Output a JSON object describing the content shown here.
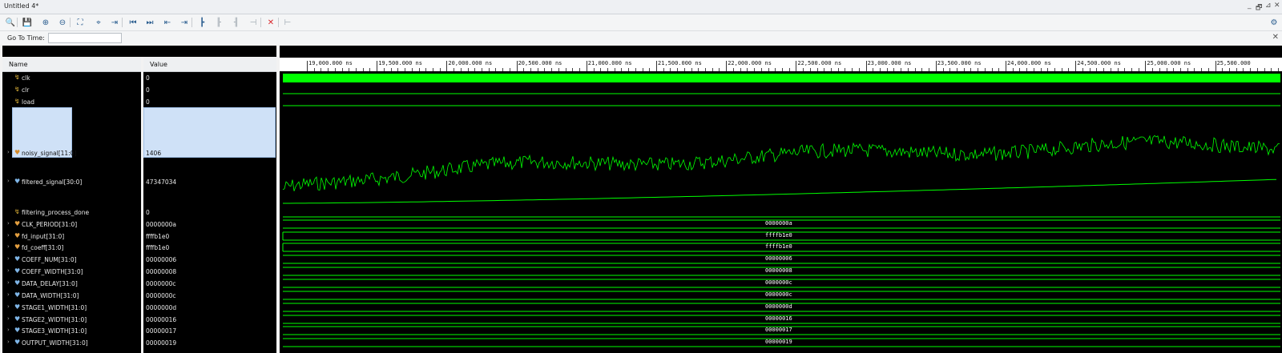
{
  "window": {
    "title": "Untitled 4*",
    "controls": [
      "_",
      "🗗",
      "⊿",
      "✕"
    ]
  },
  "toolbar": {
    "icons": [
      {
        "name": "search-icon",
        "glyph": "🔍"
      },
      {
        "name": "save-icon",
        "glyph": "💾"
      },
      {
        "name": "zoom-in-icon",
        "glyph": "⊕"
      },
      {
        "name": "zoom-out-icon",
        "glyph": "⊖"
      },
      {
        "name": "zoom-fit-icon",
        "glyph": "⛶"
      },
      {
        "name": "cursor-center-icon",
        "glyph": "⌖"
      },
      {
        "name": "go-to-cursor-icon",
        "glyph": "⇥"
      },
      {
        "name": "go-to-start-icon",
        "glyph": "⏮"
      },
      {
        "name": "go-to-end-icon",
        "glyph": "⏭"
      },
      {
        "name": "prev-transition-icon",
        "glyph": "⇤"
      },
      {
        "name": "next-transition-icon",
        "glyph": "⇥"
      },
      {
        "name": "add-marker-icon",
        "glyph": "┣"
      },
      {
        "name": "prev-marker-icon",
        "glyph": "╟"
      },
      {
        "name": "next-marker-icon",
        "glyph": "╢"
      },
      {
        "name": "swap-cursors-icon",
        "glyph": "⊣"
      },
      {
        "name": "delete-icon",
        "glyph": "✕"
      },
      {
        "name": "snap-icon",
        "glyph": "⊢"
      }
    ],
    "settings_glyph": "⚙"
  },
  "goto": {
    "label": "Go To Time:",
    "value": "",
    "close": "✕"
  },
  "columns": {
    "name": "Name",
    "value": "Value"
  },
  "signals": [
    {
      "name": "clk",
      "value": "0",
      "kind": "bit",
      "expand": false
    },
    {
      "name": "clr",
      "value": "0",
      "kind": "bit",
      "expand": false
    },
    {
      "name": "load",
      "value": "0",
      "kind": "bit",
      "expand": false
    },
    {
      "name": "noisy_signal[11:0]",
      "value": "1406",
      "kind": "analog",
      "expand": true,
      "selected": true
    },
    {
      "name": "filtered_signal[30:0]",
      "value": "47347034",
      "kind": "analog",
      "expand": true
    },
    {
      "name": "filtering_process_done",
      "value": "0",
      "kind": "bit",
      "expand": false
    },
    {
      "name": "CLK_PERIOD[31:0]",
      "value": "0000000a",
      "bus": "0000000a",
      "kind": "param",
      "expand": true
    },
    {
      "name": "fd_input[31:0]",
      "value": "ffffb1e0",
      "bus": "ffffb1e0",
      "kind": "param",
      "expand": true
    },
    {
      "name": "fd_coeff[31:0]",
      "value": "ffffb1e0",
      "bus": "ffffb1e0",
      "kind": "param",
      "expand": true
    },
    {
      "name": "COEFF_NUM[31:0]",
      "value": "00000006",
      "bus": "00000006",
      "kind": "param",
      "expand": true
    },
    {
      "name": "COEFF_WIDTH[31:0]",
      "value": "00000008",
      "bus": "00000008",
      "kind": "param",
      "expand": true
    },
    {
      "name": "DATA_DELAY[31:0]",
      "value": "0000000c",
      "bus": "0000000c",
      "kind": "param",
      "expand": true
    },
    {
      "name": "DATA_WIDTH[31:0]",
      "value": "0000000c",
      "bus": "0000000c",
      "kind": "param",
      "expand": true
    },
    {
      "name": "STAGE1_WIDTH[31:0]",
      "value": "0000000d",
      "bus": "0000000d",
      "kind": "param",
      "expand": true
    },
    {
      "name": "STAGE2_WIDTH[31:0]",
      "value": "00000016",
      "bus": "00000016",
      "kind": "param",
      "expand": true
    },
    {
      "name": "STAGE3_WIDTH[31:0]",
      "value": "00000017",
      "bus": "00000017",
      "kind": "param",
      "expand": true
    },
    {
      "name": "OUTPUT_WIDTH[31:0]",
      "value": "00000019",
      "bus": "00000019",
      "kind": "param",
      "expand": true
    }
  ],
  "ruler": {
    "labels": [
      "19,000.000 ns",
      "19,500.000 ns",
      "20,000.000 ns",
      "20,500.000 ns",
      "21,000.000 ns",
      "21,500.000 ns",
      "22,000.000 ns",
      "22,500.000 ns",
      "23,000.000 ns",
      "23,500.000 ns",
      "24,000.000 ns",
      "24,500.000 ns",
      "25,000.000 ns",
      "25,500.000"
    ]
  },
  "colors": {
    "wave": "#00ff00",
    "selection": "#cfe1f7",
    "background": "#000000"
  }
}
